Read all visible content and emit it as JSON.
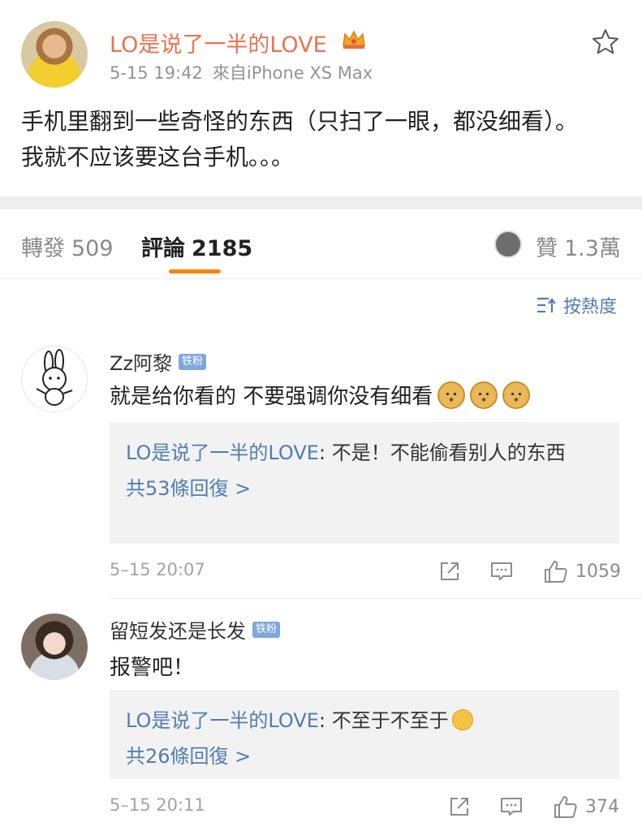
{
  "post": {
    "author": "LO是说了一半的LOVE",
    "time": "5-15 19:42",
    "source": "來自iPhone XS Max",
    "text": "手机里翻到一些奇怪的东西（只扫了一眼，都没细看）。我就不应该要这台手机。。。"
  },
  "tabs": {
    "repost_label": "轉發",
    "repost_count": "509",
    "comment_label": "評論",
    "comment_count": "2185",
    "like_label": "贊",
    "like_count": "1.3萬"
  },
  "sort": {
    "label": "按熱度"
  },
  "comments": [
    {
      "name": "Zz阿黎",
      "badge": "铁粉",
      "text": "就是给你看的 不要强调你没有细看",
      "reply_name": "LO是说了一半的LOVE",
      "reply_text": ": 不是！不能偷看别人的东西",
      "reply_more": "共53條回復 >",
      "time": "5–15 20:07",
      "likes": "1059"
    },
    {
      "name": "留短发还是长发",
      "badge": "铁粉",
      "text": "报警吧！",
      "reply_name": "LO是说了一半的LOVE",
      "reply_text": ": 不至于不至于",
      "reply_more": "共26條回復 >",
      "time": "5–15 20:11",
      "likes": "374"
    }
  ],
  "colors": {
    "accent_orange": "#eb7350",
    "link_blue": "#507daf",
    "tab_indicator": "#ff8200",
    "badge_blue": "#7fa6dd"
  },
  "icons": {
    "favorite": "star-icon",
    "vip": "crown-icon",
    "sort": "sort-icon",
    "share": "share-icon",
    "comment": "comment-icon",
    "like": "thumbs-up-icon"
  }
}
